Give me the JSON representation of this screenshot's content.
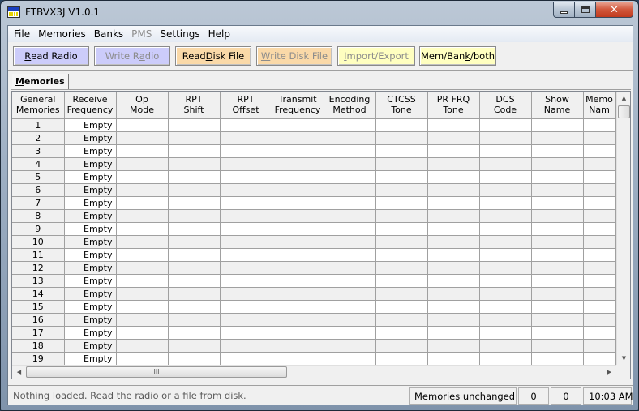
{
  "window": {
    "title": "FTBVX3J V1.0.1",
    "close_glyph": "✕"
  },
  "menu": [
    {
      "label": "File",
      "enabled": true
    },
    {
      "label": "Memories",
      "enabled": true
    },
    {
      "label": "Banks",
      "enabled": true
    },
    {
      "label": "PMS",
      "enabled": false
    },
    {
      "label": "Settings",
      "enabled": true
    },
    {
      "label": "Help",
      "enabled": true
    }
  ],
  "toolbar": {
    "read_radio": {
      "pre": "",
      "ul": "R",
      "post": "ead Radio",
      "color": "#ccccfa",
      "enabled": true
    },
    "write_radio": {
      "pre": "Write R",
      "ul": "a",
      "post": "dio",
      "color": "#ccccfa",
      "enabled": false
    },
    "read_disk": {
      "pre": "Read ",
      "ul": "D",
      "post": "isk File",
      "color": "#fad9a8",
      "enabled": true
    },
    "write_disk": {
      "pre": "",
      "ul": "W",
      "post": "rite Disk File",
      "color": "#fad9a8",
      "enabled": false
    },
    "import_export": {
      "pre": "",
      "ul": "I",
      "post": "mport/Export",
      "color": "#ffffc0",
      "enabled": false
    },
    "mem_bank": {
      "pre": "Mem/Ban",
      "ul": "k",
      "post": "/both",
      "color": "#ffffc0",
      "enabled": true
    }
  },
  "tabs": [
    {
      "ul": "M",
      "rest": "emories",
      "active": true
    }
  ],
  "grid": {
    "columns": [
      "General Memories",
      "Receive Frequency",
      "Op Mode",
      "RPT Shift",
      "RPT Offset",
      "Transmit Frequency",
      "Encoding Method",
      "CTCSS Tone",
      "PR FRQ Tone",
      "DCS Code",
      "Show Name",
      "Memory Name"
    ],
    "column_lines": [
      [
        "General",
        "Memories"
      ],
      [
        "Receive",
        "Frequency"
      ],
      [
        "Op",
        "Mode"
      ],
      [
        "RPT",
        "Shift"
      ],
      [
        "RPT",
        "Offset"
      ],
      [
        "Transmit",
        "Frequency"
      ],
      [
        "Encoding",
        "Method"
      ],
      [
        "CTCSS",
        "Tone"
      ],
      [
        "PR FRQ",
        "Tone"
      ],
      [
        "DCS",
        "Code"
      ],
      [
        "Show",
        "Name"
      ],
      [
        "Memo",
        "Nam"
      ]
    ],
    "rows": [
      {
        "num": "1",
        "freq": "Empty"
      },
      {
        "num": "2",
        "freq": "Empty"
      },
      {
        "num": "3",
        "freq": "Empty"
      },
      {
        "num": "4",
        "freq": "Empty"
      },
      {
        "num": "5",
        "freq": "Empty"
      },
      {
        "num": "6",
        "freq": "Empty"
      },
      {
        "num": "7",
        "freq": "Empty"
      },
      {
        "num": "8",
        "freq": "Empty"
      },
      {
        "num": "9",
        "freq": "Empty"
      },
      {
        "num": "10",
        "freq": "Empty"
      },
      {
        "num": "11",
        "freq": "Empty"
      },
      {
        "num": "12",
        "freq": "Empty"
      },
      {
        "num": "13",
        "freq": "Empty"
      },
      {
        "num": "14",
        "freq": "Empty"
      },
      {
        "num": "15",
        "freq": "Empty"
      },
      {
        "num": "16",
        "freq": "Empty"
      },
      {
        "num": "17",
        "freq": "Empty"
      },
      {
        "num": "18",
        "freq": "Empty"
      },
      {
        "num": "19",
        "freq": "Empty"
      }
    ]
  },
  "scroll": {
    "up": "▲",
    "down": "▼",
    "left": "◀",
    "right": "▶",
    "grip": "III"
  },
  "status": {
    "message": "Nothing loaded. Read the radio or a file from disk.",
    "memories_state": "Memories unchanged",
    "count1": "0",
    "count2": "0",
    "time": "10:03 AM"
  }
}
